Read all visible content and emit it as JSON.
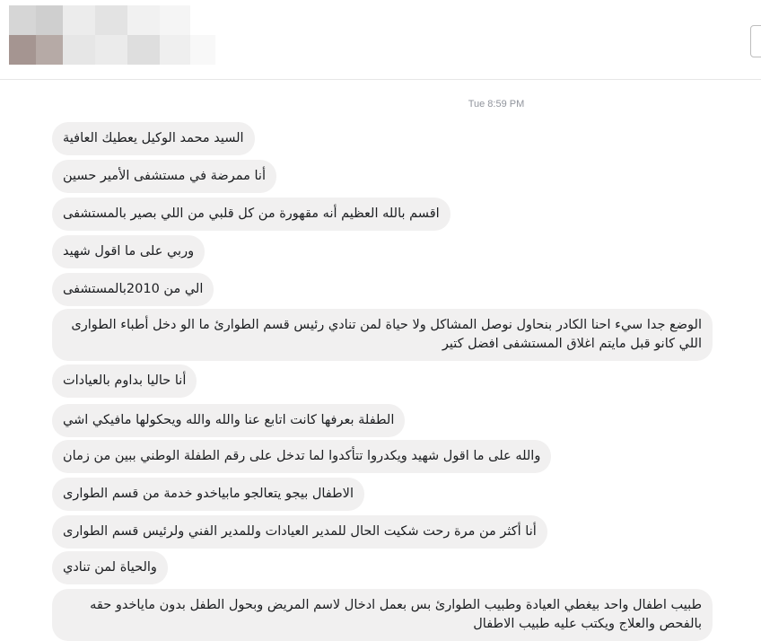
{
  "header": {
    "contact_name": ""
  },
  "thread": {
    "timestamp": "Tue 8:59 PM",
    "messages": [
      "السيد محمد الوكيل يعطيك العافية",
      "أنا ممرضة في مستشفى الأمير حسين",
      "اقسم بالله العظيم أنه مقهورة من كل قلبي من اللي بصير بالمستشفى",
      "وربي على ما اقول شهيد",
      "الي من 2010بالمستشفى",
      "الوضع جدا سيء احنا الكادر بنحاول نوصل المشاكل ولا حياة لمن تنادي رئيس قسم الطوارئ ما الو دخل أطباء الطوارى اللي كانو قبل مايتم اغلاق المستشفى افضل كتير",
      "أنا حاليا بداوم بالعيادات",
      "الطفلة بعرفها كانت اتابع عنا والله والله ويحكولها مافيكي اشي",
      "والله على ما اقول شهيد  ويكدروا تتأكدوا لما تدخل على رقم الطفلة الوطني ببين من زمان",
      "الاطفال بيجو يتعالجو مابياخدو خدمة من قسم الطوارى",
      "أنا أكثر من مرة رحت شكيت الحال للمدير العيادات وللمدير الفني ولرئيس قسم الطوارى",
      "والحياة لمن تنادي",
      "طبيب اطفال واحد بيغطي العيادة وطبيب الطوارئ بس بعمل ادخال لاسم المريض وبحول الطفل بدون ماياخدو حقه بالفحص والعلاج ويكتب عليه طبيب الاطفال"
    ]
  }
}
